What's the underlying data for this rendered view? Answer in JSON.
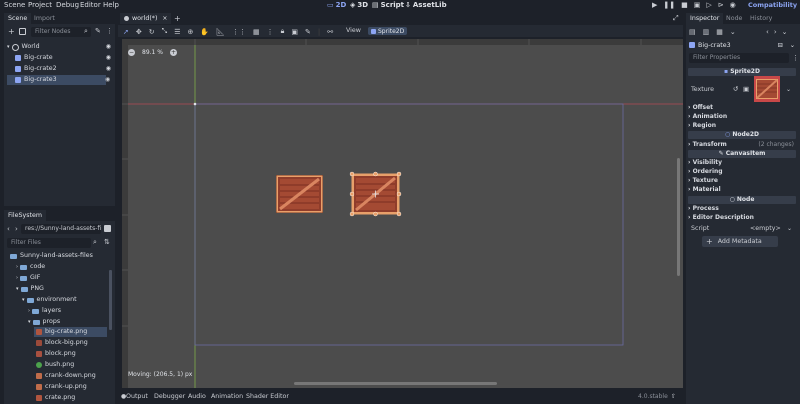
{
  "menu": [
    "Scene",
    "Project",
    "Debug",
    "Editor",
    "Help"
  ],
  "modes": {
    "m2d": "2D",
    "m3d": "3D",
    "script": "Script",
    "assetlib": "AssetLib"
  },
  "renderer": "Compatibility",
  "scene_panel": {
    "tabs": [
      "Scene",
      "Import"
    ],
    "filter_placeholder": "Filter Nodes",
    "nodes": [
      {
        "label": "World"
      },
      {
        "label": "Big-crate"
      },
      {
        "label": "Big-crate2"
      },
      {
        "label": "Big-crate3"
      }
    ]
  },
  "filesystem": {
    "tab": "FileSystem",
    "path": "res://Sunny-land-assets-file",
    "filter_placeholder": "Filter Files",
    "items": [
      {
        "label": "Sunny-land-assets-files",
        "kind": "folder"
      },
      {
        "label": "code",
        "kind": "folder"
      },
      {
        "label": "GIF",
        "kind": "folder"
      },
      {
        "label": "PNG",
        "kind": "folder"
      },
      {
        "label": "environment",
        "kind": "folder"
      },
      {
        "label": "layers",
        "kind": "folder"
      },
      {
        "label": "props",
        "kind": "folder"
      },
      {
        "label": "big-crate.png",
        "kind": "file"
      },
      {
        "label": "block-big.png",
        "kind": "file"
      },
      {
        "label": "block.png",
        "kind": "file"
      },
      {
        "label": "bush.png",
        "kind": "file"
      },
      {
        "label": "crank-down.png",
        "kind": "file"
      },
      {
        "label": "crank-up.png",
        "kind": "file"
      },
      {
        "label": "crate.png",
        "kind": "file"
      }
    ]
  },
  "editor": {
    "tab": "world(*)",
    "view_label": "View",
    "sprite_btn": "Sprite2D",
    "zoom": "89.1 %",
    "status": "Moving: (206.5, 1) px"
  },
  "inspector": {
    "tabs": [
      "Inspector",
      "Node",
      "History"
    ],
    "node_name": "Big-crate3",
    "filter_placeholder": "Filter Properties",
    "class_header": "Sprite2D",
    "texture_label": "Texture",
    "sections1": [
      "Offset",
      "Animation",
      "Region"
    ],
    "node2d_header": "Node2D",
    "transform_label": "Transform",
    "transform_note": "(2 changes)",
    "canvas_header": "CanvasItem",
    "sections2": [
      "Visibility",
      "Ordering",
      "Texture",
      "Material"
    ],
    "node_header": "Node",
    "sections3": [
      "Process",
      "Editor Description"
    ],
    "script_label": "Script",
    "script_value": "<empty>",
    "add_metadata": "Add Metadata"
  },
  "bottom": {
    "tabs": [
      "Output",
      "Debugger",
      "Audio",
      "Animation",
      "Shader Editor"
    ],
    "version": "4.0.stable"
  },
  "colors": {
    "accent": "#699ce8",
    "panel": "#252a33",
    "viewport": "#4c4c4c",
    "selected": "#3c4b63"
  }
}
